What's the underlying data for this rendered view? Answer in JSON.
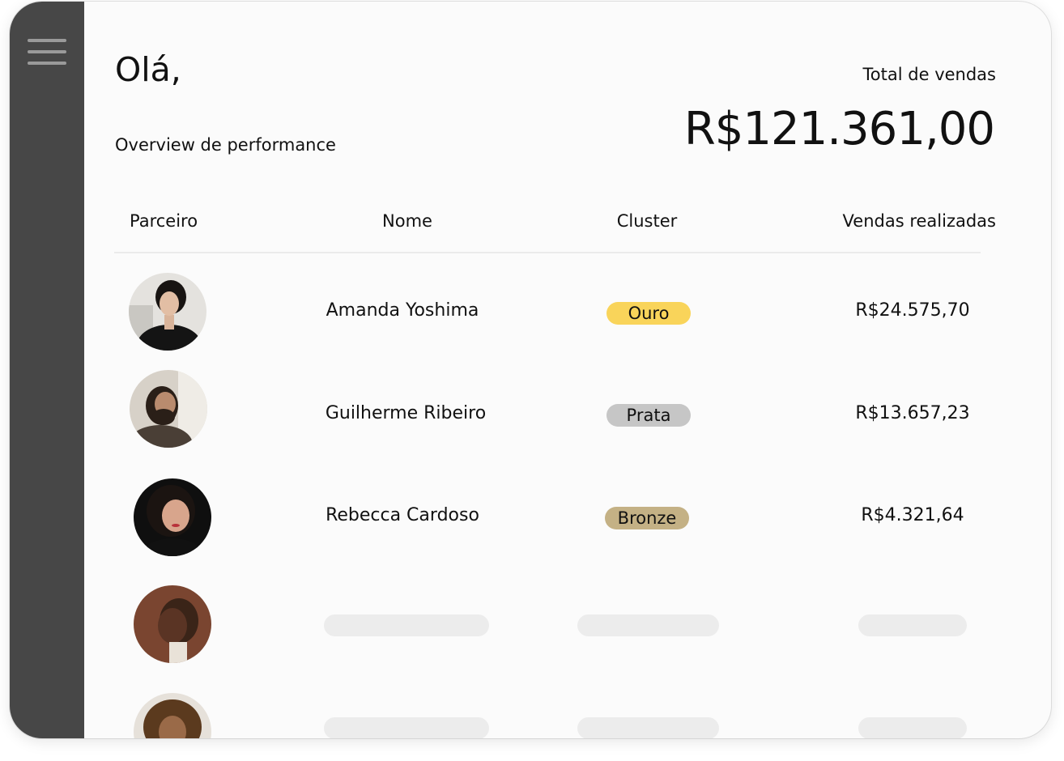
{
  "header": {
    "greeting": "Olá,",
    "subtitle": "Overview de performance",
    "total_label": "Total de vendas",
    "total_value": "R$121.361,00"
  },
  "table": {
    "columns": [
      "Parceiro",
      "Nome",
      "Cluster",
      "Vendas realizadas"
    ],
    "rows": [
      {
        "name": "Amanda Yoshima",
        "cluster": "Ouro",
        "sales": "R$24.575,70"
      },
      {
        "name": "Guilherme Ribeiro",
        "cluster": "Prata",
        "sales": "R$13.657,23"
      },
      {
        "name": "Rebecca Cardoso",
        "cluster": "Bronze",
        "sales": "R$4.321,64"
      }
    ],
    "loading_rows": 2
  },
  "colors": {
    "sidebar": "#474747",
    "gold": "#f9d45a",
    "silver": "#c6c6c6",
    "bronze": "#c4b185",
    "skeleton": "#ececec"
  },
  "icons": {
    "menu": "hamburger-menu-icon"
  }
}
